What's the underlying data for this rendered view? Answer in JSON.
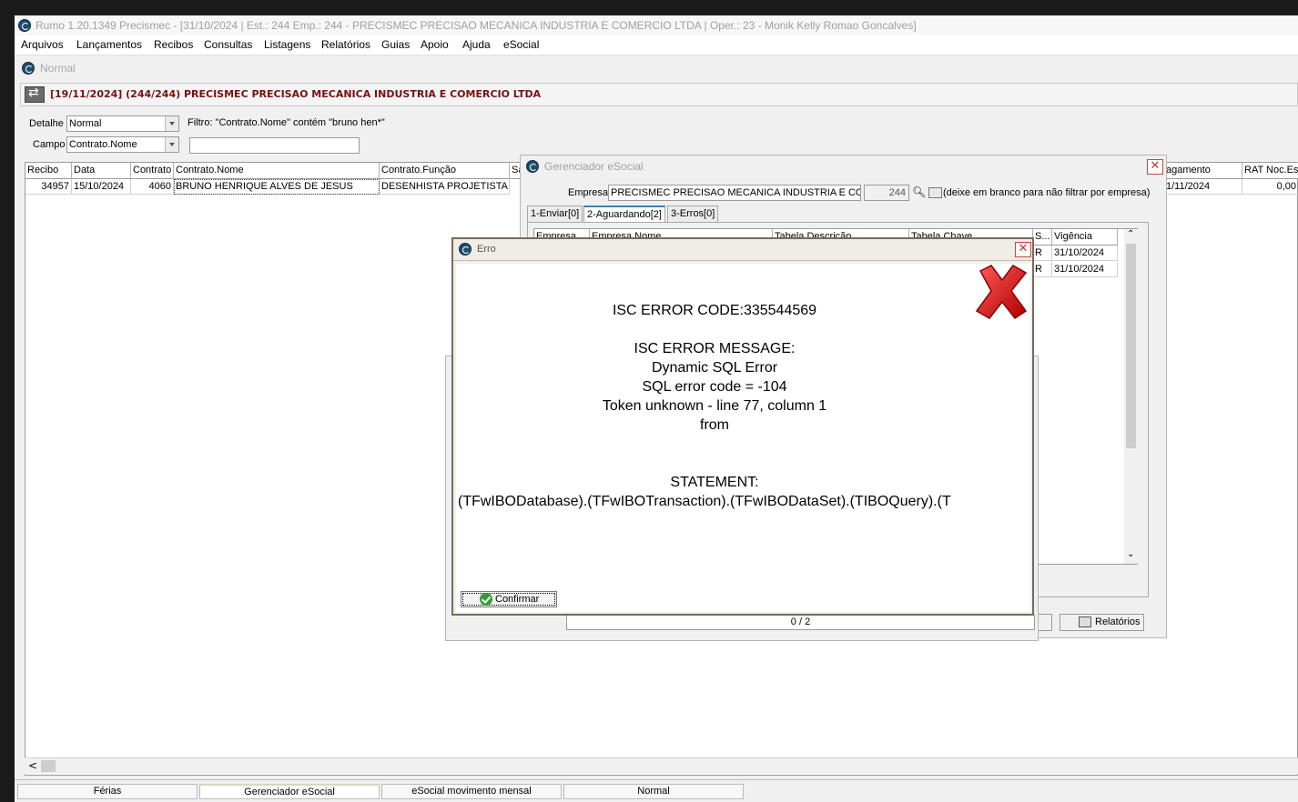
{
  "window": {
    "title": "Rumo 1.20.1349 Precismec - [31/10/2024 | Est.: 244 Emp.: 244 - PRECISMEC PRECISAO MECANICA INDUSTRIA E COMERCIO LTDA | Oper.: 23 - Monik Kelly Romao Goncalves]"
  },
  "menu": [
    "Arquivos",
    "Lançamentos",
    "Recibos",
    "Consultas",
    "Listagens",
    "Relatórios",
    "Guias",
    "Apoio",
    "Ajuda",
    "eSocial"
  ],
  "inner_title": "Normal",
  "header": "[19/11/2024] (244/244) PRECISMEC PRECISAO MECANICA INDUSTRIA E COMERCIO LTDA",
  "filters": {
    "detalhe_label": "Detalhe",
    "detalhe_value": "Normal",
    "filtro_text": "Filtro: \"Contrato.Nome\" contém \"bruno hen*\"",
    "campo_label": "Campo",
    "campo_value": "Contrato.Nome",
    "search_value": ""
  },
  "grid": {
    "columns": [
      "Recibo",
      "Data",
      "Contrato",
      "Contrato.Nome",
      "Contrato.Função",
      "Sa",
      "agamento",
      "RAT Noc.Est"
    ],
    "row": [
      "34957",
      "15/10/2024",
      "4060",
      "BRUNO HENRIQUE ALVES DE JESUS",
      "DESENHISTA PROJETISTA VI",
      "",
      "1/11/2024",
      "0,00"
    ]
  },
  "taskbar": [
    "Férias",
    "Gerenciador eSocial",
    "eSocial movimento mensal",
    "Normal"
  ],
  "esocial": {
    "title": "Gerenciador eSocial",
    "empresa_label": "Empresa",
    "empresa_value": "PRECISMEC PRECISAO MECANICA INDUSTRIA E COMERCIO",
    "empresa_code": "244",
    "empresa_hint": "(deixe em branco para não filtrar por empresa)",
    "tabs": [
      "1-Enviar[0]",
      "2-Aguardando[2]",
      "3-Erros[0]"
    ],
    "columns": [
      "Empresa",
      "Empresa.Nome",
      "Tabela.Descrição",
      "Tabela.Chave",
      "S...",
      "Vigência"
    ],
    "rows": [
      {
        "s": "R",
        "vigencia": "31/10/2024"
      },
      {
        "s": "R",
        "vigencia": "31/10/2024"
      }
    ],
    "progress": "0 / 2",
    "relatorios_label": "Relatórios"
  },
  "error": {
    "title": "Erro",
    "lines": [
      "ISC ERROR CODE:335544569",
      "",
      "ISC ERROR MESSAGE:",
      "Dynamic SQL Error",
      "SQL error code = -104",
      "Token unknown - line 77, column 1",
      "from",
      "",
      "",
      "STATEMENT:",
      "(TFwIBODatabase).(TFwIBOTransaction).(TFwIBODataSet).(TIBOQuery).(T"
    ],
    "confirm_label": "Confirmar"
  }
}
